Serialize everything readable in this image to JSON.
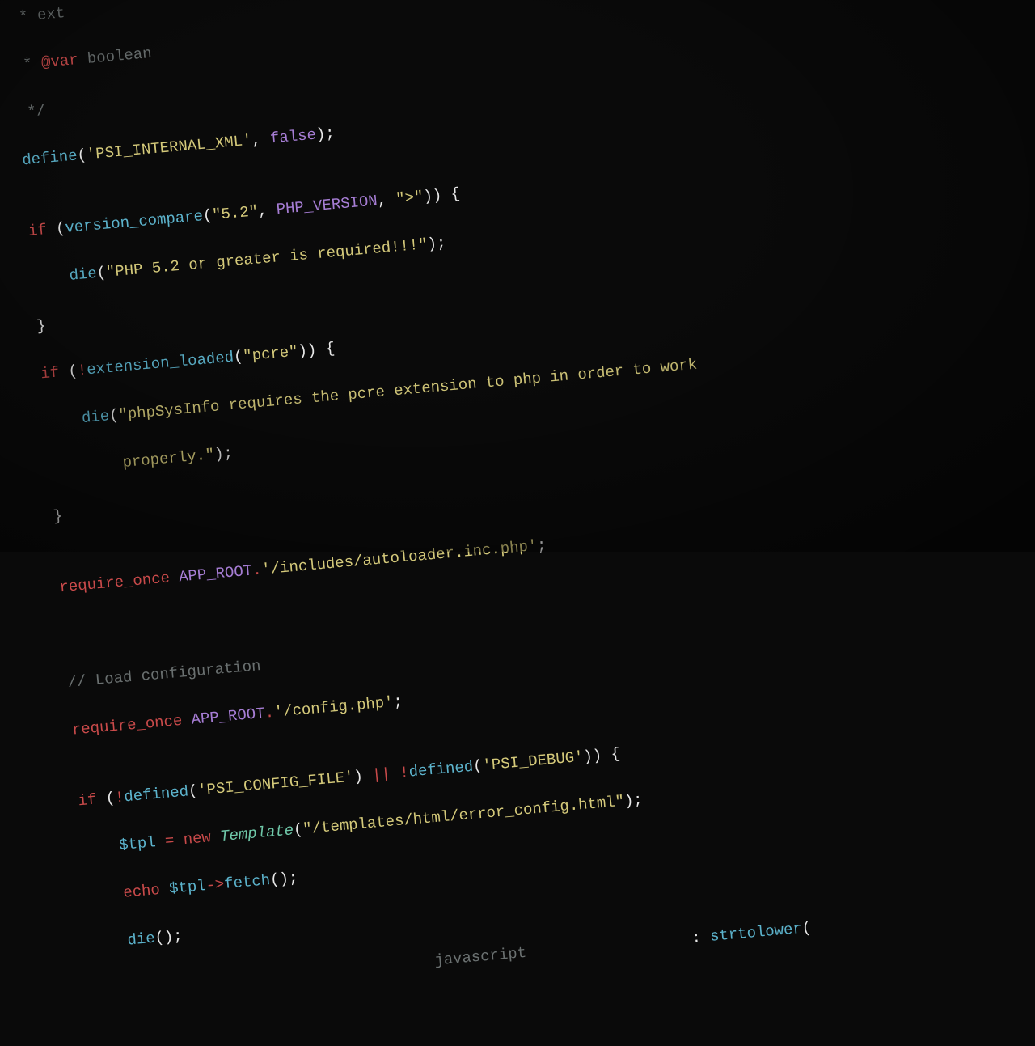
{
  "code": {
    "l0": " * ext",
    "l1_star": " * ",
    "l1_tag": "@var",
    "l1_type": " boolean",
    "l2": " */",
    "l3_func": "define",
    "l3_p1": "(",
    "l3_str1": "'PSI_INTERNAL_XML'",
    "l3_comma": ", ",
    "l3_bool": "false",
    "l3_p2": ");",
    "l5_kw": "if ",
    "l5_p1": "(",
    "l5_func": "version_compare",
    "l5_p2": "(",
    "l5_str1": "\"5.2\"",
    "l5_c1": ", ",
    "l5_const": "PHP_VERSION",
    "l5_c2": ", ",
    "l5_str2": "\">\"",
    "l5_p3": ")) {",
    "l6_func": "die",
    "l6_p1": "(",
    "l6_str": "\"PHP 5.2 or greater is required!!!\"",
    "l6_p2": ");",
    "l7": "}",
    "l8_kw": "if ",
    "l8_p1": "(",
    "l8_op": "!",
    "l8_func": "extension_loaded",
    "l8_p2": "(",
    "l8_str": "\"pcre\"",
    "l8_p3": ")) {",
    "l9_func": "die",
    "l9_p1": "(",
    "l9_str": "\"phpSysInfo requires the pcre extension to php in order to work",
    "l10_str": "properly.\"",
    "l10_p": ");",
    "l11": "}",
    "l13_kw": "require_once ",
    "l13_const": "APP_ROOT",
    "l13_op": ".",
    "l13_str": "'/includes/autoloader.inc.php'",
    "l13_p": ";",
    "l16_comment": "// Load configuration",
    "l17_kw": "require_once ",
    "l17_const": "APP_ROOT",
    "l17_op": ".",
    "l17_str": "'/config.php'",
    "l17_p": ";",
    "l19_kw": "if ",
    "l19_p1": "(",
    "l19_op1": "!",
    "l19_func1": "defined",
    "l19_p2": "(",
    "l19_str1": "'PSI_CONFIG_FILE'",
    "l19_p3": ") ",
    "l19_op2": "||",
    "l19_sp": " ",
    "l19_op3": "!",
    "l19_func2": "defined",
    "l19_p4": "(",
    "l19_str2": "'PSI_DEBUG'",
    "l19_p5": ")) {",
    "l20_var": "$tpl",
    "l20_eq": " = ",
    "l20_new": "new ",
    "l20_class": "Template",
    "l20_p1": "(",
    "l20_str": "\"/templates/html/error_config.html\"",
    "l20_p2": ");",
    "l21_echo": "echo ",
    "l21_var": "$tpl",
    "l21_op": "->",
    "l21_func": "fetch",
    "l21_p": "();",
    "l22_func": "die",
    "l22_p": "();",
    "l24_comment": "javascript",
    "l24_tail": " : ",
    "l24_func": "strtolower",
    "l24_p": "("
  }
}
